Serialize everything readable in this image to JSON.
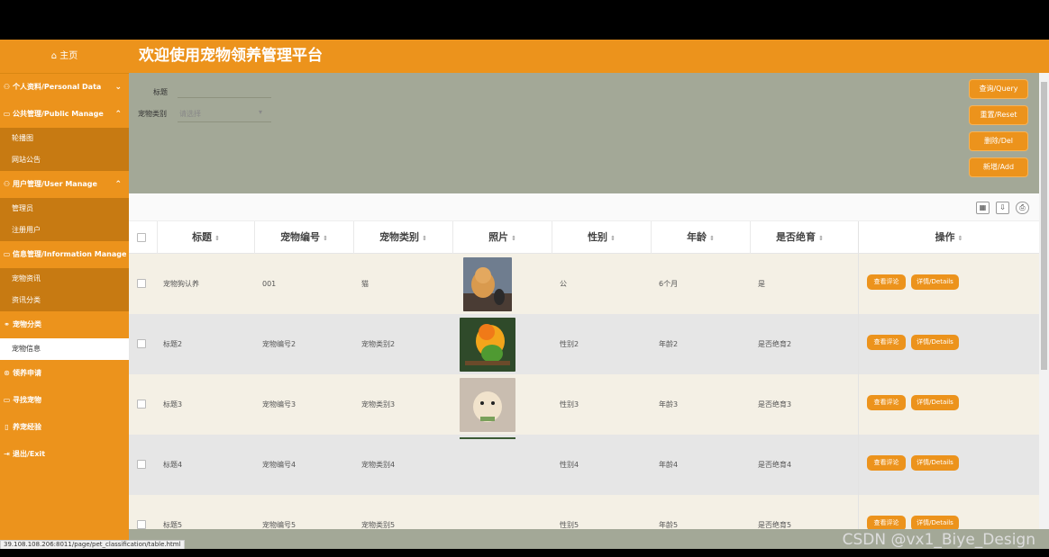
{
  "sidebar": {
    "home": "主页",
    "groups": [
      {
        "label": "个人资料/Personal Data",
        "icon": "person-icon",
        "chev": "⌄",
        "items": []
      },
      {
        "label": "公共管理/Public Manage",
        "icon": "monitor-icon",
        "chev": "⌃",
        "items": [
          "轮播图",
          "网站公告"
        ]
      },
      {
        "label": "用户管理/User Manage",
        "icon": "user-icon",
        "chev": "⌃",
        "items": [
          "管理员",
          "注册用户"
        ]
      },
      {
        "label": "信息管理/Information Manage",
        "icon": "info-icon",
        "chev": "",
        "items": [
          "宠物资讯",
          "资讯分类"
        ]
      },
      {
        "label": "宠物分类",
        "icon": "tag-icon",
        "chev": "",
        "items": [
          "宠物信息"
        ]
      },
      {
        "label": "领养申请",
        "icon": "apply-icon",
        "chev": "",
        "items": []
      },
      {
        "label": "寻找宠物",
        "icon": "find-icon",
        "chev": "",
        "items": []
      },
      {
        "label": "养宠经验",
        "icon": "doc-icon",
        "chev": "",
        "items": []
      },
      {
        "label": "退出/Exit",
        "icon": "exit-icon",
        "chev": "",
        "items": []
      }
    ]
  },
  "header": {
    "title": "欢迎使用宠物领养管理平台"
  },
  "search": {
    "title_label": "标题",
    "type_label": "宠物类别",
    "type_placeholder": "请选择",
    "buttons": [
      "查询/Query",
      "重置/Reset",
      "删除/Del",
      "新增/Add"
    ]
  },
  "table": {
    "columns": [
      "标题",
      "宠物编号",
      "宠物类别",
      "照片",
      "性别",
      "年龄",
      "是否绝育",
      "操作"
    ],
    "rows": [
      {
        "title": "宠物狗认养",
        "code": "001",
        "type": "猫",
        "gender": "公",
        "age": "6个月",
        "neutered": "是"
      },
      {
        "title": "标题2",
        "code": "宠物编号2",
        "type": "宠物类别2",
        "gender": "性别2",
        "age": "年龄2",
        "neutered": "是否绝育2"
      },
      {
        "title": "标题3",
        "code": "宠物编号3",
        "type": "宠物类别3",
        "gender": "性别3",
        "age": "年龄3",
        "neutered": "是否绝育3"
      },
      {
        "title": "标题4",
        "code": "宠物编号4",
        "type": "宠物类别4",
        "gender": "性别4",
        "age": "年龄4",
        "neutered": "是否绝育4"
      },
      {
        "title": "标题5",
        "code": "宠物编号5",
        "type": "宠物类别5",
        "gender": "性别5",
        "age": "年龄5",
        "neutered": "是否绝育5"
      }
    ],
    "row_buttons": [
      "查看评论",
      "详情/Details"
    ]
  },
  "status_url": "39.108.108.206:8011/page/pet_classification/table.html",
  "watermark": "CSDN @vx1_Biye_Design",
  "colors": {
    "accent": "#ec931c",
    "panel": "#a3a897"
  }
}
